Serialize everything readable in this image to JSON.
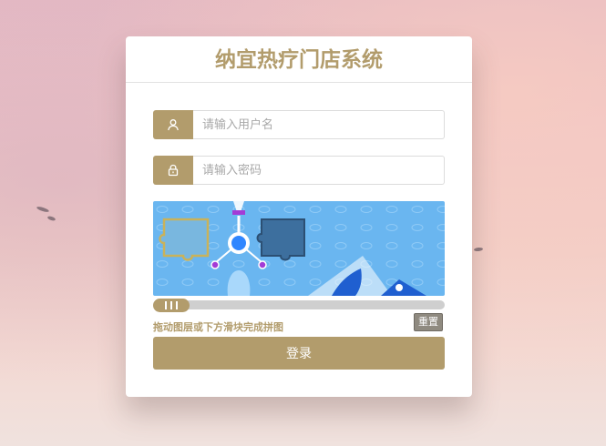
{
  "app": {
    "title": "纳宜热疗门店系统"
  },
  "form": {
    "username": {
      "icon": "user-icon",
      "value": "",
      "placeholder": "请输入用户名"
    },
    "password": {
      "icon": "lock-icon",
      "value": "",
      "placeholder": "请输入密码"
    }
  },
  "captcha": {
    "hint": "拖动图层或下方滑块完成拼图",
    "reset_label": "重置",
    "slider_progress": 0,
    "colors": {
      "sky": "#6ab6f0",
      "piece_outline": "#c9b25a",
      "hole": "#3d6f9e"
    }
  },
  "actions": {
    "login_label": "登录"
  },
  "theme": {
    "accent": "#b29c6c",
    "reset_bg": "#8f8a80"
  }
}
